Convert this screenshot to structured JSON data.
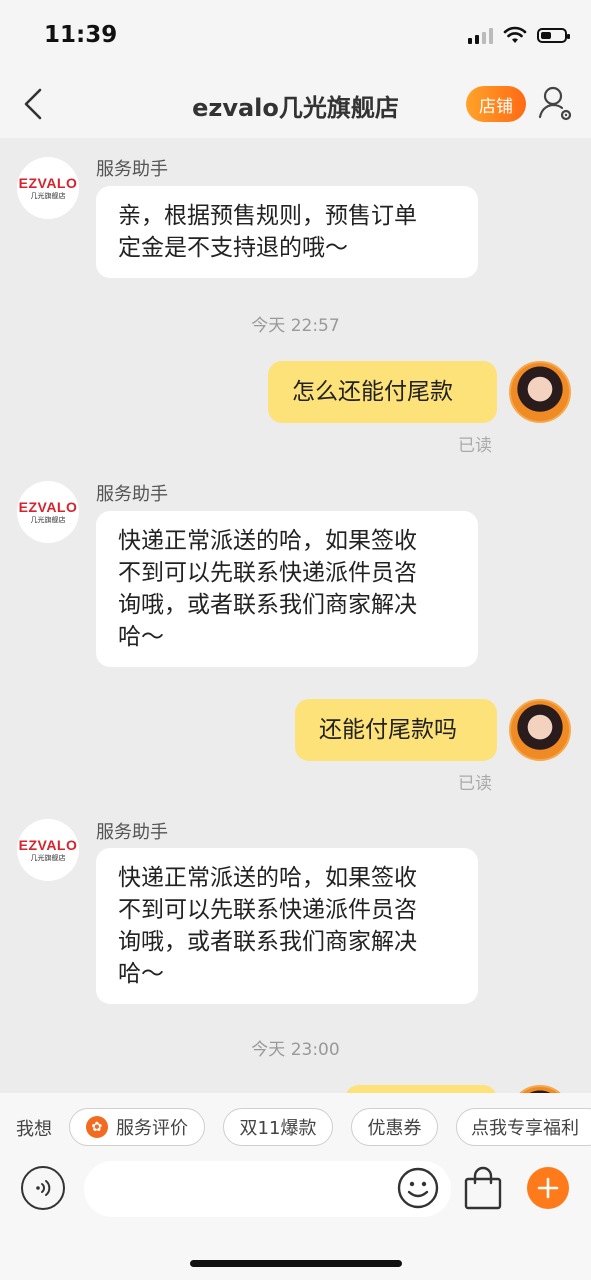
{
  "status_bar": {
    "time": "11:39"
  },
  "nav": {
    "title": "ezvalo几光旗舰店",
    "store_button": "店铺"
  },
  "store_avatar": {
    "brand": "EZVALO",
    "subtitle": "几光旗舰店"
  },
  "messages": [
    {
      "type": "incoming",
      "sender": "服务助手",
      "lines": [
        "亲，根据预售规则，预售订单",
        "定金是不支持退的哦～"
      ]
    },
    {
      "type": "timestamp",
      "text": "今天 22:57"
    },
    {
      "type": "outgoing",
      "text": "怎么还能付尾款",
      "status": "已读"
    },
    {
      "type": "incoming",
      "sender": "服务助手",
      "lines": [
        "快递正常派送的哈，如果签收",
        "不到可以先联系快递派件员咨",
        "询哦，或者联系我们商家解决",
        "哈～"
      ]
    },
    {
      "type": "outgoing",
      "text": "还能付尾款吗",
      "status": "已读"
    },
    {
      "type": "incoming",
      "sender": "服务助手",
      "lines": [
        "快递正常派送的哈，如果签收",
        "不到可以先联系快递派件员咨",
        "询哦，或者联系我们商家解决",
        "哈～"
      ]
    },
    {
      "type": "timestamp",
      "text": "今天 23:00"
    }
  ],
  "quick_bar": {
    "label": "我想",
    "chips": [
      "服务评价",
      "双11爆款",
      "优惠券",
      "点我专享福利"
    ]
  },
  "input": {
    "placeholder": ""
  },
  "colors": {
    "accent": "#ff7a1a",
    "bubble_out": "#fde27a",
    "bubble_in": "#ffffff",
    "brand_red": "#d6232c"
  },
  "icons": [
    "back-icon",
    "profile-settings-icon",
    "voice-icon",
    "emoji-icon",
    "shopping-bag-icon",
    "plus-icon"
  ]
}
